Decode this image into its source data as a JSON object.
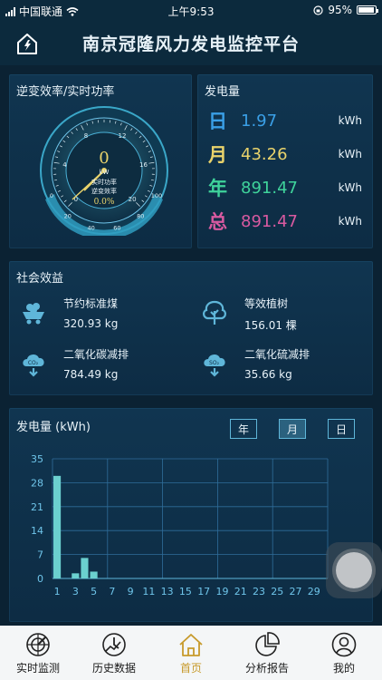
{
  "status_bar": {
    "carrier": "中国联通",
    "time": "上午9:53",
    "battery": "95%",
    "battery_level": 0.95
  },
  "header": {
    "title": "南京冠隆风力发电监控平台",
    "home_icon": "home-icon"
  },
  "gauge": {
    "panel_title": "逆变效率/实时功率",
    "outer_ticks": [
      "0",
      "4",
      "8",
      "12",
      "16",
      "20"
    ],
    "inner_ticks": [
      "0",
      "20",
      "40",
      "60",
      "80",
      "100"
    ],
    "power_value": "0",
    "power_unit": "kW",
    "label_power": "实时功率",
    "label_efficiency": "逆变效率",
    "efficiency_value": "0.0%",
    "power_level": 0,
    "efficiency_level": 0
  },
  "generation": {
    "panel_title": "发电量",
    "rows": [
      {
        "label": "日",
        "value": "1.97",
        "unit": "kWh",
        "color": "#3a9fe6"
      },
      {
        "label": "月",
        "value": "43.26",
        "unit": "kWh",
        "color": "#e9d36b"
      },
      {
        "label": "年",
        "value": "891.47",
        "unit": "kWh",
        "color": "#3fd39b"
      },
      {
        "label": "总",
        "value": "891.47",
        "unit": "kWh",
        "color": "#d85aa0"
      }
    ]
  },
  "social": {
    "panel_title": "社会效益",
    "items": [
      {
        "name": "节约标准煤",
        "amount": "320.93 kg",
        "icon": "coal-cart-icon"
      },
      {
        "name": "等效植树",
        "amount": "156.01 棵",
        "icon": "tree-icon"
      },
      {
        "name": "二氧化碳减排",
        "amount": "784.49 kg",
        "icon": "co2-cloud-icon"
      },
      {
        "name": "二氧化硫减排",
        "amount": "35.66 kg",
        "icon": "so2-cloud-icon"
      }
    ]
  },
  "chart_panel": {
    "title": "发电量 (kWh)",
    "buttons": {
      "year": "年",
      "month": "月",
      "day": "日"
    },
    "active_button": "month"
  },
  "chart_data": {
    "type": "bar",
    "title": "发电量 (kWh)",
    "xlabel": "",
    "ylabel": "",
    "x": [
      1,
      2,
      3,
      4,
      5,
      6,
      7,
      8,
      9,
      10,
      11,
      12,
      13,
      14,
      15,
      16,
      17,
      18,
      19,
      20,
      21,
      22,
      23,
      24,
      25,
      26,
      27,
      28,
      29,
      30
    ],
    "values": [
      30,
      0,
      1.5,
      6,
      2,
      0,
      0,
      0,
      0,
      0,
      0,
      0,
      0,
      0,
      0,
      0,
      0,
      0,
      0,
      0,
      0,
      0,
      0,
      0,
      0,
      0,
      0,
      0,
      0,
      0
    ],
    "xticks": [
      "1",
      "3",
      "5",
      "7",
      "9",
      "11",
      "13",
      "15",
      "17",
      "19",
      "21",
      "23",
      "25",
      "27",
      "29"
    ],
    "yticks": [
      "0",
      "7",
      "14",
      "21",
      "28",
      "35"
    ],
    "ylim": [
      0,
      35
    ],
    "grid": true,
    "bar_color": "#6bd0cf"
  },
  "tabbar": {
    "active": "home",
    "items": [
      {
        "key": "realtime",
        "label": "实时监测",
        "icon": "radar-icon"
      },
      {
        "key": "history",
        "label": "历史数据",
        "icon": "clock-chart-icon"
      },
      {
        "key": "home",
        "label": "首页",
        "icon": "home-icon"
      },
      {
        "key": "analysis",
        "label": "分析报告",
        "icon": "pie-chart-icon"
      },
      {
        "key": "mine",
        "label": "我的",
        "icon": "user-icon"
      }
    ]
  }
}
